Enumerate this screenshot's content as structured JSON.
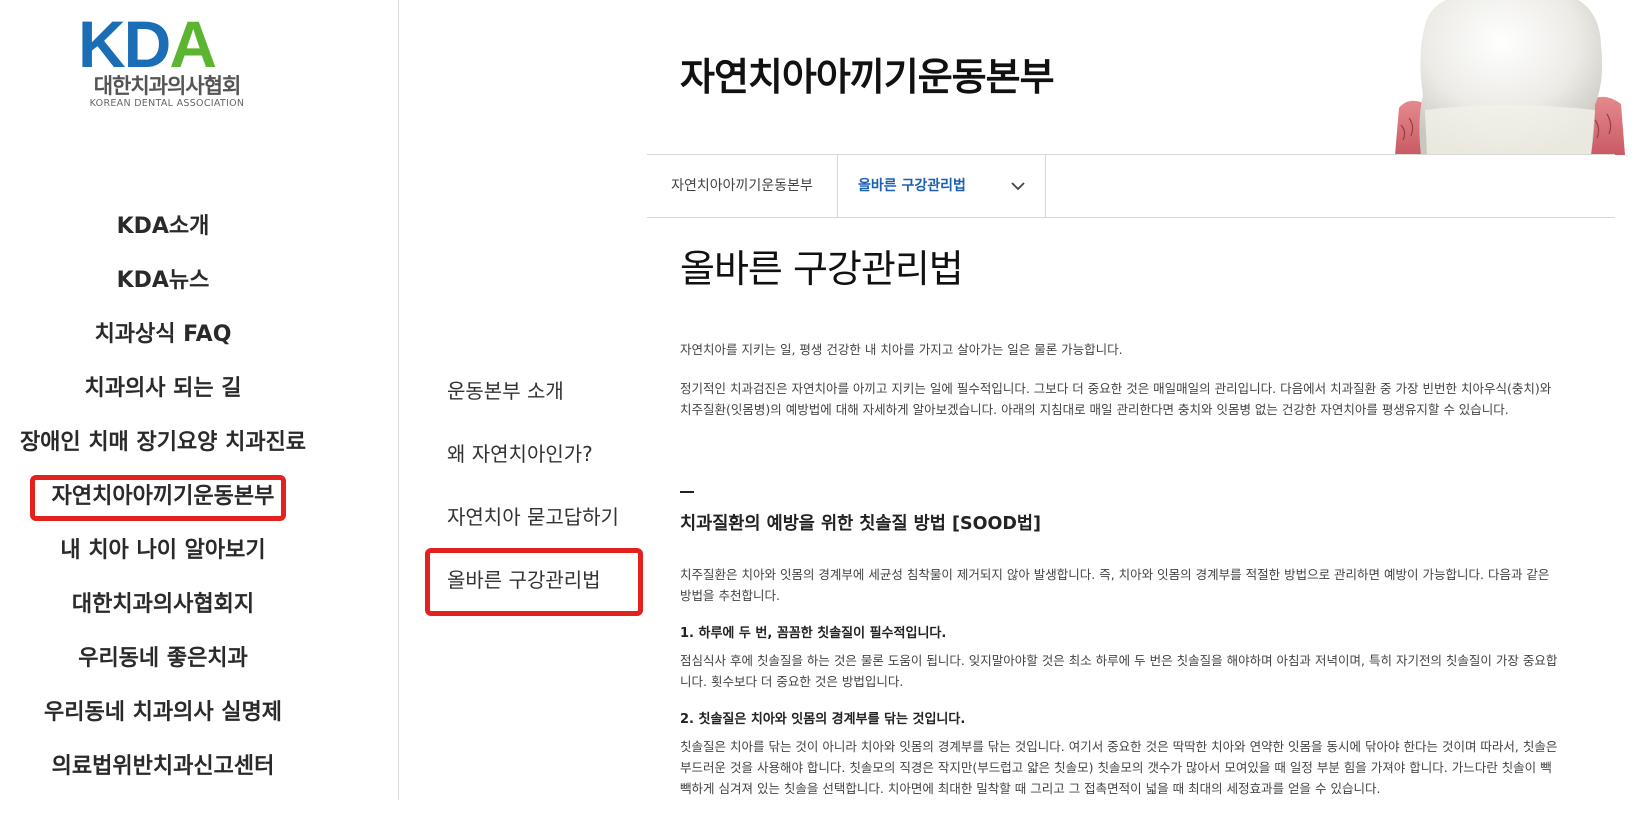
{
  "logo": {
    "letters_blue": "KD",
    "letters_green": "A",
    "name_kr": "대한치과의사협회",
    "name_en": "KOREAN DENTAL ASSOCIATION"
  },
  "main_nav": [
    {
      "label": "KDA소개"
    },
    {
      "label": "KDA뉴스"
    },
    {
      "label": "치과상식 FAQ"
    },
    {
      "label": "치과의사 되는 길"
    },
    {
      "label": "장애인 치매 장기요양 치과진료"
    },
    {
      "label": "자연치아아끼기운동본부",
      "highlighted": true
    },
    {
      "label": "내 치아 나이 알아보기"
    },
    {
      "label": "대한치과의사협회지"
    },
    {
      "label": "우리동네 좋은치과"
    },
    {
      "label": "우리동네 치과의사 실명제"
    },
    {
      "label": "의료법위반치과신고센터"
    }
  ],
  "sub_nav": [
    {
      "label": "운동본부 소개"
    },
    {
      "label": "왜 자연치아인가?"
    },
    {
      "label": "자연치아 묻고답하기"
    },
    {
      "label": "올바른 구강관리법",
      "highlighted": true
    }
  ],
  "header": {
    "title": "자연치아아끼기운동본부"
  },
  "breadcrumb": {
    "home": "자연치아아끼기운동본부",
    "current": "올바른 구강관리법"
  },
  "content": {
    "title": "올바른 구강관리법",
    "intro": "자연치아를 지키는 일, 평생 건강한 내 치아를 가지고 살아가는 일은 물론 가능합니다.",
    "para2": "정기적인 치과검진은 자연치아를 아끼고 지키는 일에 필수적입니다. 그보다 더 중요한 것은 매일매일의 관리입니다. 다음에서 치과질환 중 가장 빈번한 치아우식(충치)와 치주질환(잇몸병)의 예방법에 대해 자세하게 알아보겠습니다. 아래의 지침대로 매일 관리한다면 충치와 잇몸병 없는 건강한 자연치아를 평생유지할 수 있습니다.",
    "heading": "치과질환의 예방을 위한 칫솔질 방법 [SOOD법]",
    "para3": "치주질환은 치아와 잇몸의 경계부에 세균성 침착물이 제거되지 않아 발생합니다. 즉, 치아와 잇몸의 경계부를 적절한 방법으로 관리하면 예방이 가능합니다. 다음과 같은 방법을 추천합니다.",
    "step1_title": "1. 하루에 두 번, 꼼꼼한 칫솔질이 필수적입니다.",
    "step1_text": "점심식사 후에 칫솔질을 하는 것은 물론 도움이 됩니다. 잊지말아야할 것은 최소 하루에 두 번은 칫솔질을 해야하며 아침과 저녁이며, 특히 자기전의 칫솔질이 가장 중요합니다. 횟수보다 더 중요한 것은 방법입니다.",
    "step2_title": "2. 칫솔질은 치아와 잇몸의 경계부를 닦는 것입니다.",
    "step2_text": "칫솔질은 치아를 닦는 것이 아니라 치아와 잇몸의 경계부를 닦는 것입니다. 여기서 중요한 것은 딱딱한 치아와 연약한 잇몸을 동시에 닦아야 한다는 것이며 따라서, 칫솔은 부드러운 것을 사용해야 합니다. 칫솔모의 직경은 작지만(부드럽고 얇은 칫솔모) 칫솔모의 갯수가 많아서 모여있을 때 일정 부분 힘을 가져야 합니다. 가느다란 칫솔이 빽빽하게 심겨져 있는 칫솔을 선택합니다. 치아면에 최대한 밀착할 때 그리고 그 접촉면적이 넓을 때 최대의 세정효과를 얻을 수 있습니다."
  },
  "colors": {
    "logo_blue": "#1b6db5",
    "logo_green": "#5cb531",
    "highlight_red": "#e3211f",
    "breadcrumb_active": "#1a5fb4"
  },
  "icons": {
    "dropdown": "chevron-down-icon",
    "hero": "tooth-icon"
  }
}
